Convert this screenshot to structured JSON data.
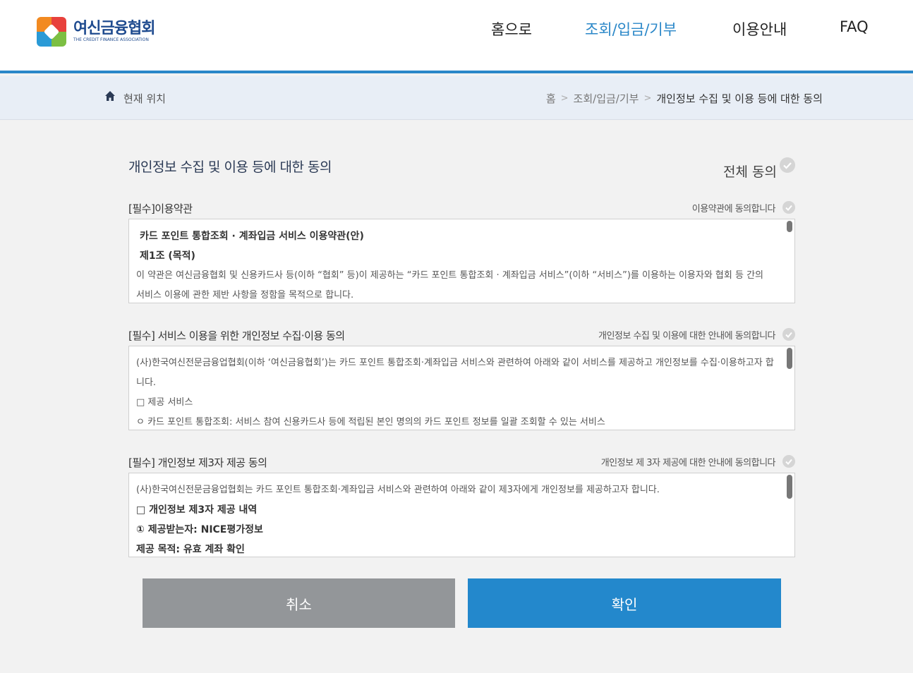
{
  "header": {
    "logo_ko": "여신금융협회",
    "logo_en": "THE CREDIT FINANCE ASSOCIATION",
    "nav": [
      {
        "label": "홈으로"
      },
      {
        "label": "조회/입금/기부",
        "active": true
      },
      {
        "label": "이용안내"
      },
      {
        "label": "FAQ"
      }
    ]
  },
  "location": {
    "label": "현재 위치",
    "crumbs": [
      "홈",
      "조회/입금/기부",
      "개인정보 수집 및 이용 등에 대한 동의"
    ]
  },
  "main": {
    "title": "개인정보 수집 및 이용 등에 대한 동의",
    "agree_all": "전체 동의",
    "sections": [
      {
        "title": "[필수]이용약관",
        "agree": "이용약관에 동의합니다",
        "lines": [
          "카드 포인트 통합조회 · 계좌입금 서비스 이용약관(안)",
          "제1조 (목적)",
          "이 약관은 여신금융협회 및 신용카드사 등(이하 “협회” 등)이 제공하는 “카드 포인트 통합조회 · 계좌입금 서비스”(이하 “서비스”)를 이용하는 이용자와 협회 등 간의 서비스 이용에 관한 제반 사항을 정함을 목적으로 합니다."
        ]
      },
      {
        "title": "[필수] 서비스 이용을 위한 개인정보 수집·이용 동의",
        "agree": "개인정보 수집 및 이용에 대한 안내에 동의합니다",
        "lines": [
          "(사)한국여신전문금융업협회(이하 ‘여신금융협회’)는 카드 포인트 통합조회·계좌입금 서비스와 관련하여 아래와 같이 서비스를 제공하고 개인정보를 수집·이용하고자 합니다.",
          "□ 제공 서비스",
          "ㅇ 카드 포인트 통합조회: 서비스 참여 신용카드사 등에 적립된 본인 명의의 카드 포인트 정보를 일괄 조회할 수 있는 서비스"
        ]
      },
      {
        "title": "[필수] 개인정보 제3자 제공 동의",
        "agree": "개인정보 제 3자 제공에 대한 안내에 동의합니다",
        "lines": [
          "(사)한국여신전문금융업협회는 카드 포인트 통합조회·계좌입금 서비스와 관련하여 아래와 같이 제3자에게 개인정보를 제공하고자 합니다.",
          "□ 개인정보 제3자 제공 내역",
          "① 제공받는자: NICE평가정보",
          "제공 목적: 유효 계좌 확인"
        ]
      }
    ]
  },
  "buttons": {
    "cancel": "취소",
    "confirm": "확인"
  },
  "colors": {
    "accent": "#2a87c8",
    "cancel_bg": "#939699",
    "confirm_bg": "#2388cc"
  }
}
